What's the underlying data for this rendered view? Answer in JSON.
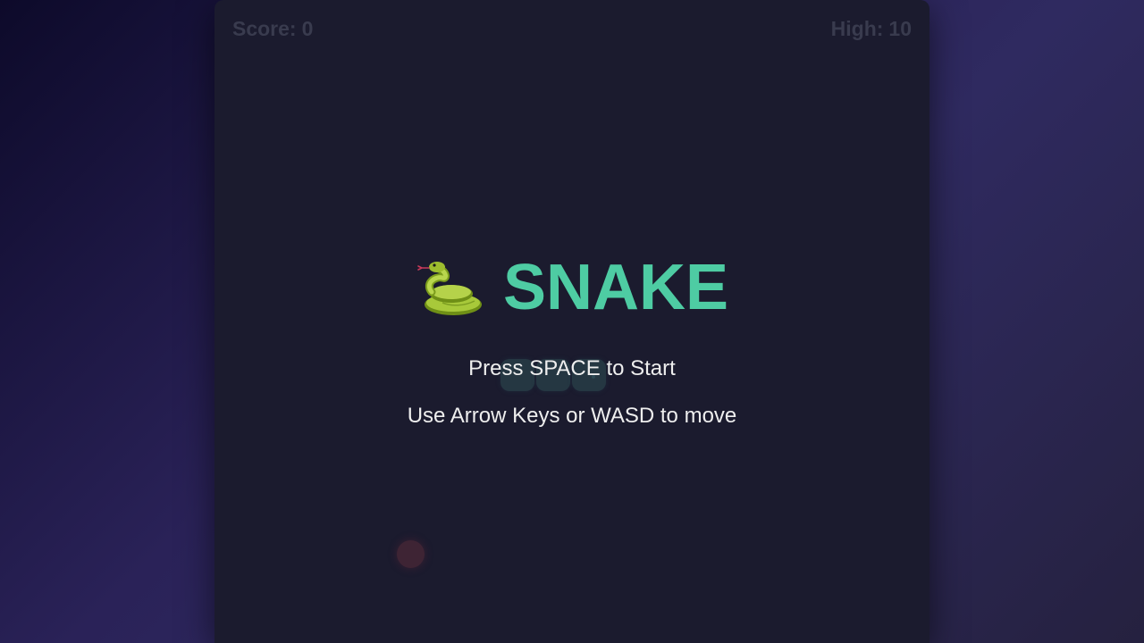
{
  "hud": {
    "score_label": "Score:",
    "score_value": "0",
    "high_label": "High:",
    "high_value": "10"
  },
  "overlay": {
    "title_icon": "snake-icon",
    "title_text": "SNAKE",
    "start_prompt": "Press SPACE to Start",
    "controls_hint": "Use Arrow Keys or WASD to move"
  },
  "game_state": {
    "snake_length": 3,
    "direction": "right",
    "paused": true
  },
  "colors": {
    "accent": "#4ecca3",
    "board": "#1b1b2e",
    "text": "#eeeeee",
    "hud_text": "#393b4e",
    "food": "#e94560"
  }
}
